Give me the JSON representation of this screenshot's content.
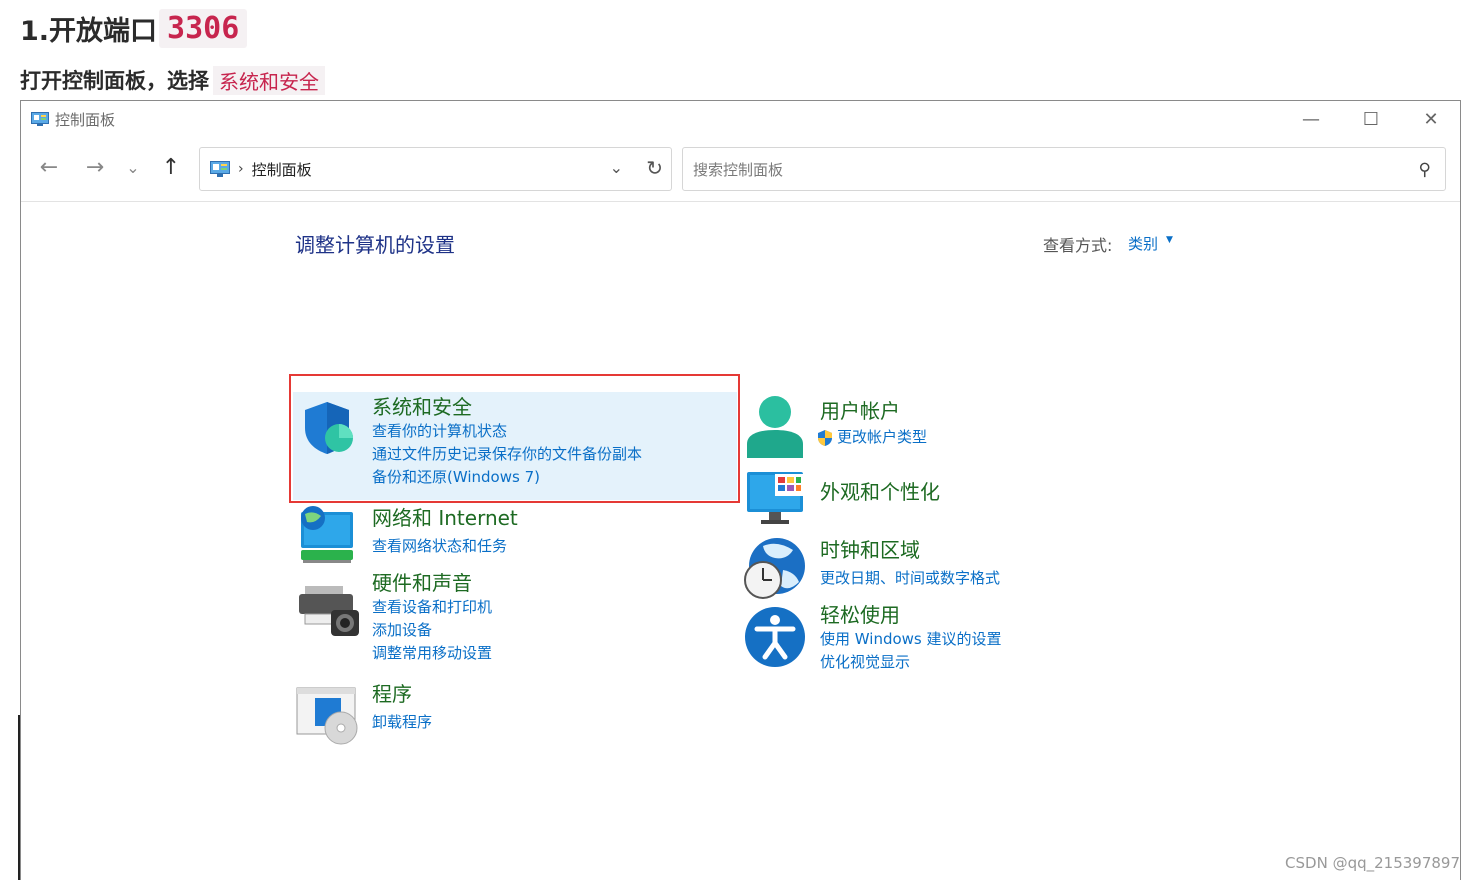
{
  "article": {
    "heading_prefix": "1.开放端口",
    "heading_code": "3306",
    "instruction_prefix": "打开控制面板，选择",
    "instruction_code": "系统和安全"
  },
  "window": {
    "title": "控制面板",
    "controls": {
      "minimize": "—",
      "maximize": "☐",
      "close": "✕"
    }
  },
  "navbar": {
    "back": "←",
    "forward": "→",
    "recent": "⌄",
    "up": "↑",
    "address_separator": "›",
    "address": "控制面板",
    "address_dropdown": "⌄",
    "refresh": "↻",
    "search_placeholder": "搜索控制面板",
    "search_icon": "⚲"
  },
  "content": {
    "title": "调整计算机的设置",
    "view_by_label": "查看方式:",
    "view_by_value": "类别",
    "categories_left": [
      {
        "title": "系统和安全",
        "icon": "shield-icon",
        "links": [
          "查看你的计算机状态",
          "通过文件历史记录保存你的文件备份副本",
          "备份和还原(Windows 7)"
        ],
        "selected": true
      },
      {
        "title": "网络和 Internet",
        "icon": "network-icon",
        "links": [
          "查看网络状态和任务"
        ]
      },
      {
        "title": "硬件和声音",
        "icon": "printer-icon",
        "links": [
          "查看设备和打印机",
          "添加设备",
          "调整常用移动设置"
        ]
      },
      {
        "title": "程序",
        "icon": "programs-icon",
        "links": [
          "卸载程序"
        ]
      }
    ],
    "categories_right": [
      {
        "title": "用户帐户",
        "icon": "user-icon",
        "links": [
          "更改帐户类型"
        ]
      },
      {
        "title": "外观和个性化",
        "icon": "monitor-icon",
        "links": []
      },
      {
        "title": "时钟和区域",
        "icon": "clock-globe-icon",
        "links": [
          "更改日期、时间或数字格式"
        ]
      },
      {
        "title": "轻松使用",
        "icon": "accessibility-icon",
        "links": [
          "使用 Windows 建议的设置",
          "优化视觉显示"
        ]
      }
    ]
  },
  "watermark": "CSDN @qq_215397897",
  "colors": {
    "title_blue": "#1e3287",
    "link_blue": "#0a6fc7",
    "category_green": "#1d6a22",
    "highlight_red": "#e53935",
    "code_red": "#c7254e"
  }
}
